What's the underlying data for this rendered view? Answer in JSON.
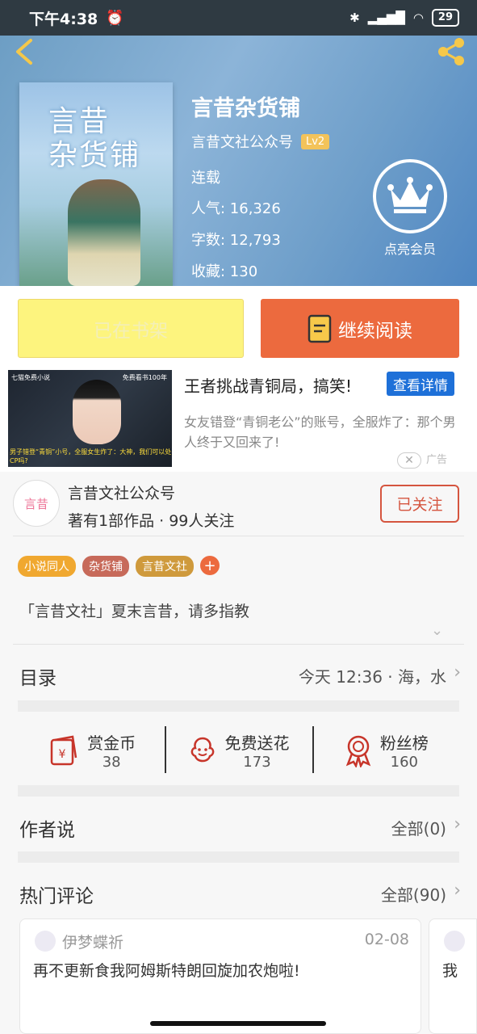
{
  "status_bar": {
    "time": "下午4:38",
    "battery": "29"
  },
  "book": {
    "title": "言昔杂货铺",
    "cover_title": "言昔\n杂货铺",
    "author": "言昔文社公众号",
    "level": "Lv2",
    "status": "连载",
    "popularity": "人气: 16,326",
    "words": "字数: 12,793",
    "favorites": "收藏: 130",
    "vip_label": "点亮会员"
  },
  "actions": {
    "shelf": "已在书架",
    "read": "继续阅读"
  },
  "ad": {
    "image_topleft": "七猫免费小说",
    "image_topright": "免费看书100年",
    "image_caption": "男子错登“青铜”小号，全服女生炸了：大神，我们可以处CP吗?",
    "title": "王者挑战青铜局，搞笑!",
    "button": "查看详情",
    "description": "女友错登“青铜老公”的账号，全服炸了：那个男人终于又回来了!",
    "close": "✕",
    "label": "广告"
  },
  "author_card": {
    "avatar_text": "言昔",
    "name": "言昔文社公众号",
    "stats": "著有1部作品 · 99人关注",
    "follow": "已关注"
  },
  "tags": [
    {
      "label": "小说同人",
      "color": "#f0a830"
    },
    {
      "label": "杂货铺",
      "color": "#c76a5a"
    },
    {
      "label": "言昔文社",
      "color": "#cf9a3c"
    }
  ],
  "tag_add": "+",
  "intro": "「言昔文社」夏末言昔，请多指教",
  "catalog": {
    "title": "目录",
    "latest": "今天 12:36 · 海，水"
  },
  "gifts": [
    {
      "label": "赏金币",
      "count": "38",
      "icon": "coin-envelope-icon"
    },
    {
      "label": "免费送花",
      "count": "173",
      "icon": "flower-icon"
    },
    {
      "label": "粉丝榜",
      "count": "160",
      "icon": "medal-icon"
    }
  ],
  "author_says": {
    "title": "作者说",
    "all": "全部(0)"
  },
  "hot_comments": {
    "title": "热门评论",
    "all": "全部(90)",
    "items": [
      {
        "user": "伊梦蝶祈",
        "date": "02-08",
        "text": "再不更新食我阿姆斯特朗回旋加农炮啦!"
      },
      {
        "user": "",
        "date": "",
        "text": "我"
      }
    ]
  },
  "colors": {
    "accent": "#ec6a3e",
    "shelf": "#fdf47e",
    "ad_button": "#1e70d8",
    "follow": "#d5553f"
  }
}
